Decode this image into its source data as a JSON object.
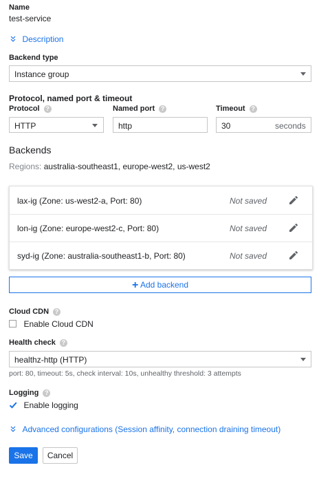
{
  "name": {
    "label": "Name",
    "value": "test-service"
  },
  "description_link": "Description",
  "backend_type": {
    "label": "Backend type",
    "value": "Instance group"
  },
  "protocol_section": {
    "title": "Protocol, named port & timeout",
    "protocol_label": "Protocol",
    "protocol_value": "HTTP",
    "named_port_label": "Named port",
    "named_port_value": "http",
    "timeout_label": "Timeout",
    "timeout_value": "30",
    "timeout_unit": "seconds"
  },
  "backends": {
    "title": "Backends",
    "regions_label": "Regions:",
    "regions_value": "australia-southeast1, europe-west2, us-west2",
    "items": [
      {
        "name": "lax-ig (Zone: us-west2-a, Port: 80)",
        "status": "Not saved"
      },
      {
        "name": "lon-ig (Zone: europe-west2-c, Port: 80)",
        "status": "Not saved"
      },
      {
        "name": "syd-ig (Zone: australia-southeast1-b, Port: 80)",
        "status": "Not saved"
      }
    ],
    "add_label": "Add backend"
  },
  "cloud_cdn": {
    "label": "Cloud CDN",
    "checkbox_label": "Enable Cloud CDN",
    "checked": false
  },
  "health_check": {
    "label": "Health check",
    "value": "healthz-http (HTTP)",
    "hint": "port: 80, timeout: 5s, check interval: 10s, unhealthy threshold: 3 attempts"
  },
  "logging": {
    "label": "Logging",
    "checkbox_label": "Enable logging",
    "checked": true
  },
  "advanced_link": "Advanced configurations (Session affinity, connection draining timeout)",
  "actions": {
    "save": "Save",
    "cancel": "Cancel"
  },
  "colors": {
    "accent": "#1a73e8",
    "text": "#202124",
    "muted": "#5f6368"
  }
}
